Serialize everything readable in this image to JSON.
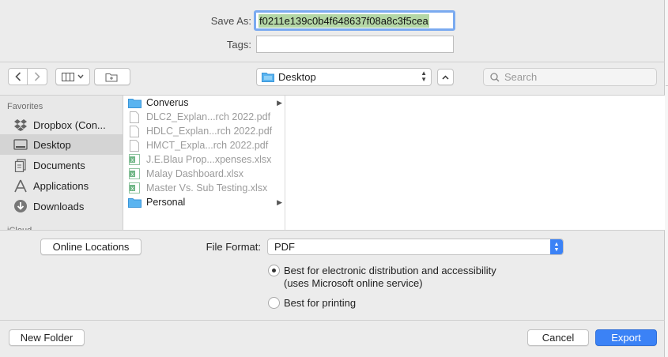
{
  "save_as": {
    "label": "Save As:",
    "value": "f0211e139c0b4f648637f08a8c3f5cea"
  },
  "tags": {
    "label": "Tags:",
    "value": ""
  },
  "toolbar": {
    "location": "Desktop",
    "search_placeholder": "Search"
  },
  "sidebar": {
    "section_favorites": "Favorites",
    "section_icloud": "iCloud",
    "items": [
      {
        "label": "Dropbox (Con...",
        "icon": "dropbox-icon"
      },
      {
        "label": "Desktop",
        "icon": "desktop-icon",
        "selected": true
      },
      {
        "label": "Documents",
        "icon": "documents-icon"
      },
      {
        "label": "Applications",
        "icon": "applications-icon"
      },
      {
        "label": "Downloads",
        "icon": "downloads-icon"
      }
    ]
  },
  "files": [
    {
      "name": "Converus",
      "type": "folder",
      "enabled": true,
      "has_children": true
    },
    {
      "name": "DLC2_Explan...rch 2022.pdf",
      "type": "pdf",
      "enabled": false
    },
    {
      "name": "HDLC_Explan...rch 2022.pdf",
      "type": "pdf",
      "enabled": false
    },
    {
      "name": "HMCT_Expla...rch 2022.pdf",
      "type": "pdf",
      "enabled": false
    },
    {
      "name": "J.E.Blau Prop...xpenses.xlsx",
      "type": "xlsx",
      "enabled": false
    },
    {
      "name": "Malay Dashboard.xlsx",
      "type": "xlsx",
      "enabled": false
    },
    {
      "name": "Master Vs. Sub Testing.xlsx",
      "type": "xlsx",
      "enabled": false
    },
    {
      "name": "Personal",
      "type": "folder",
      "enabled": true,
      "has_children": true
    }
  ],
  "options": {
    "online_locations": "Online Locations",
    "file_format_label": "File Format:",
    "file_format_value": "PDF",
    "radio_best_electronic_line1": "Best for electronic distribution and accessibility",
    "radio_best_electronic_line2": "(uses Microsoft online service)",
    "radio_best_printing": "Best for printing",
    "selected_option": "electronic"
  },
  "footer": {
    "new_folder": "New Folder",
    "cancel": "Cancel",
    "export": "Export"
  },
  "colors": {
    "accent": "#3b82f6",
    "selection_text_bg": "#b4d7a6",
    "focus_ring": "#7aaaf0",
    "folder": "#5ab4f0",
    "excel": "#3f9b5c"
  }
}
